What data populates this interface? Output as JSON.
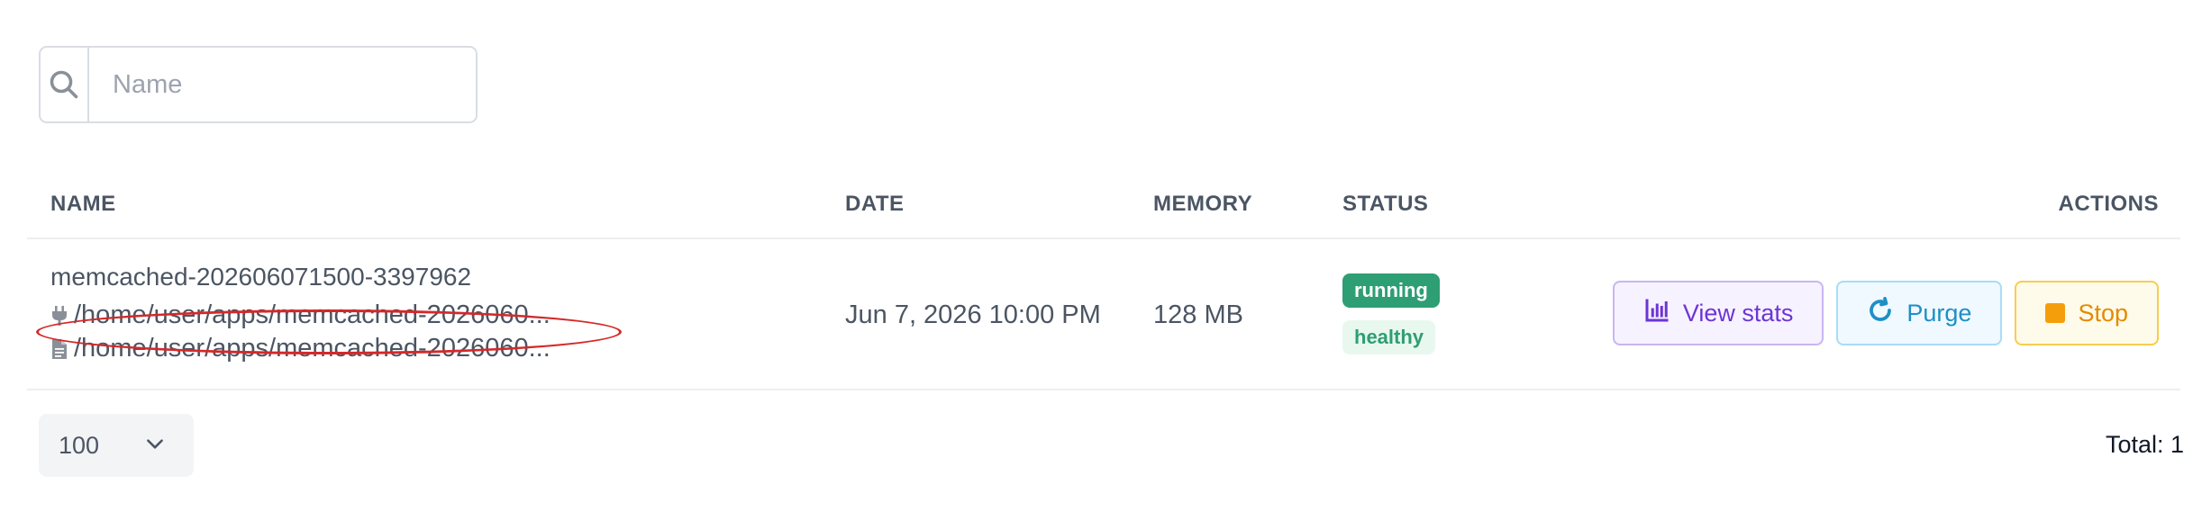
{
  "search": {
    "placeholder": "Name",
    "icon": "search-icon"
  },
  "table": {
    "columns": {
      "name": "NAME",
      "date": "DATE",
      "memory": "MEMORY",
      "status": "STATUS",
      "actions": "ACTIONS"
    },
    "rows": [
      {
        "name": "memcached-202606071500-3397962",
        "socket_path": "/home/user/apps/memcached-2026060...",
        "socket_icon": "plug-icon",
        "config_path": "/home/user/apps/memcached-2026060...",
        "config_icon": "file-icon",
        "date": "Jun 7, 2026 10:00 PM",
        "memory": "128 MB",
        "status": "running",
        "health": "healthy",
        "actions": {
          "view_stats": "View stats",
          "purge": "Purge",
          "stop": "Stop"
        }
      }
    ]
  },
  "footer": {
    "page_size": "100",
    "total": "Total: 1"
  },
  "colors": {
    "running": "#2e9e74",
    "healthy_bg": "#e8f8ef",
    "stats": "#6d34d6",
    "purge": "#1e8fc6",
    "stop": "#f59e0b",
    "annotation": "#d62828"
  }
}
